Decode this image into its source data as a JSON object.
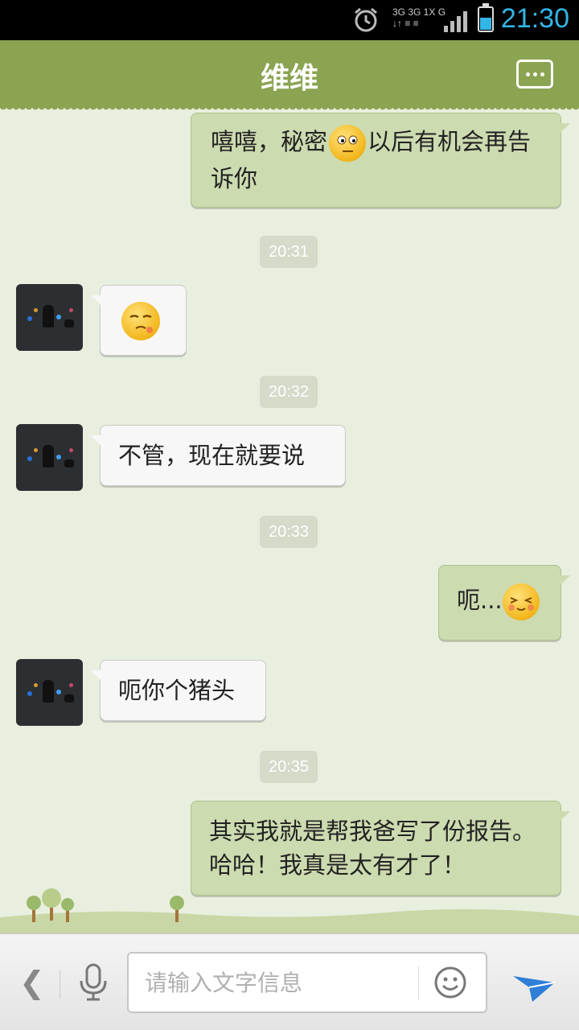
{
  "status_bar": {
    "time": "21:30",
    "network_line1": "3G 3G 1X  G",
    "network_line2": "↓↑ ≡ ≡"
  },
  "header": {
    "title": "维维",
    "more_icon": "more-options-icon"
  },
  "messages": [
    {
      "type": "out",
      "text_before": "嘻嘻，秘密",
      "emoji": "awkward",
      "text_after": "以后有机会再告诉你"
    },
    {
      "type": "time",
      "text": "20:31"
    },
    {
      "type": "in",
      "text": "",
      "emoji": "sly"
    },
    {
      "type": "time",
      "text": "20:32"
    },
    {
      "type": "in",
      "text": "不管，现在就要说"
    },
    {
      "type": "time",
      "text": "20:33"
    },
    {
      "type": "out",
      "text": "呃...",
      "emoji": "shy"
    },
    {
      "type": "in",
      "text": "呃你个猪头"
    },
    {
      "type": "time",
      "text": "20:35"
    },
    {
      "type": "out",
      "text": "其实我就是帮我爸写了份报告。哈哈！我真是太有才了！"
    }
  ],
  "input_bar": {
    "placeholder": "请输入文字信息",
    "back_icon": "chevron-left-icon",
    "mic_icon": "microphone-icon",
    "emoji_icon": "smiley-icon",
    "send_icon": "send-icon"
  },
  "colors": {
    "header_bg": "#8aa452",
    "out_bubble": "#cddbb0",
    "in_bubble": "#f7f7f7",
    "chat_bg": "#e9efdf",
    "clock": "#33b5e5"
  }
}
